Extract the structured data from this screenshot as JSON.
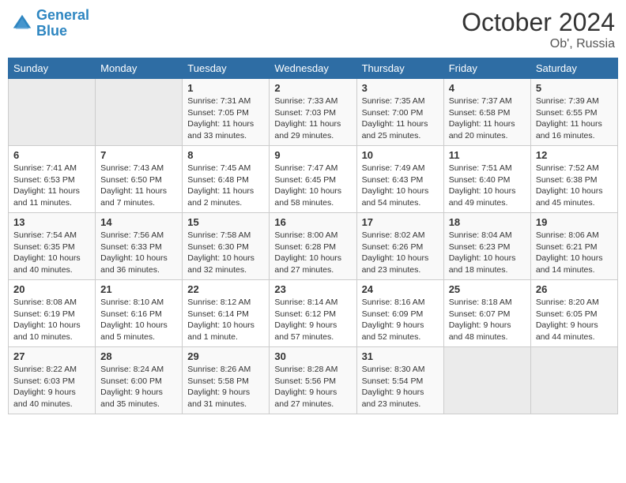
{
  "header": {
    "logo_line1": "General",
    "logo_line2": "Blue",
    "month": "October 2024",
    "location": "Ob', Russia"
  },
  "weekdays": [
    "Sunday",
    "Monday",
    "Tuesday",
    "Wednesday",
    "Thursday",
    "Friday",
    "Saturday"
  ],
  "weeks": [
    [
      null,
      null,
      {
        "day": "1",
        "sunrise": "Sunrise: 7:31 AM",
        "sunset": "Sunset: 7:05 PM",
        "daylight": "Daylight: 11 hours and 33 minutes."
      },
      {
        "day": "2",
        "sunrise": "Sunrise: 7:33 AM",
        "sunset": "Sunset: 7:03 PM",
        "daylight": "Daylight: 11 hours and 29 minutes."
      },
      {
        "day": "3",
        "sunrise": "Sunrise: 7:35 AM",
        "sunset": "Sunset: 7:00 PM",
        "daylight": "Daylight: 11 hours and 25 minutes."
      },
      {
        "day": "4",
        "sunrise": "Sunrise: 7:37 AM",
        "sunset": "Sunset: 6:58 PM",
        "daylight": "Daylight: 11 hours and 20 minutes."
      },
      {
        "day": "5",
        "sunrise": "Sunrise: 7:39 AM",
        "sunset": "Sunset: 6:55 PM",
        "daylight": "Daylight: 11 hours and 16 minutes."
      }
    ],
    [
      {
        "day": "6",
        "sunrise": "Sunrise: 7:41 AM",
        "sunset": "Sunset: 6:53 PM",
        "daylight": "Daylight: 11 hours and 11 minutes."
      },
      {
        "day": "7",
        "sunrise": "Sunrise: 7:43 AM",
        "sunset": "Sunset: 6:50 PM",
        "daylight": "Daylight: 11 hours and 7 minutes."
      },
      {
        "day": "8",
        "sunrise": "Sunrise: 7:45 AM",
        "sunset": "Sunset: 6:48 PM",
        "daylight": "Daylight: 11 hours and 2 minutes."
      },
      {
        "day": "9",
        "sunrise": "Sunrise: 7:47 AM",
        "sunset": "Sunset: 6:45 PM",
        "daylight": "Daylight: 10 hours and 58 minutes."
      },
      {
        "day": "10",
        "sunrise": "Sunrise: 7:49 AM",
        "sunset": "Sunset: 6:43 PM",
        "daylight": "Daylight: 10 hours and 54 minutes."
      },
      {
        "day": "11",
        "sunrise": "Sunrise: 7:51 AM",
        "sunset": "Sunset: 6:40 PM",
        "daylight": "Daylight: 10 hours and 49 minutes."
      },
      {
        "day": "12",
        "sunrise": "Sunrise: 7:52 AM",
        "sunset": "Sunset: 6:38 PM",
        "daylight": "Daylight: 10 hours and 45 minutes."
      }
    ],
    [
      {
        "day": "13",
        "sunrise": "Sunrise: 7:54 AM",
        "sunset": "Sunset: 6:35 PM",
        "daylight": "Daylight: 10 hours and 40 minutes."
      },
      {
        "day": "14",
        "sunrise": "Sunrise: 7:56 AM",
        "sunset": "Sunset: 6:33 PM",
        "daylight": "Daylight: 10 hours and 36 minutes."
      },
      {
        "day": "15",
        "sunrise": "Sunrise: 7:58 AM",
        "sunset": "Sunset: 6:30 PM",
        "daylight": "Daylight: 10 hours and 32 minutes."
      },
      {
        "day": "16",
        "sunrise": "Sunrise: 8:00 AM",
        "sunset": "Sunset: 6:28 PM",
        "daylight": "Daylight: 10 hours and 27 minutes."
      },
      {
        "day": "17",
        "sunrise": "Sunrise: 8:02 AM",
        "sunset": "Sunset: 6:26 PM",
        "daylight": "Daylight: 10 hours and 23 minutes."
      },
      {
        "day": "18",
        "sunrise": "Sunrise: 8:04 AM",
        "sunset": "Sunset: 6:23 PM",
        "daylight": "Daylight: 10 hours and 18 minutes."
      },
      {
        "day": "19",
        "sunrise": "Sunrise: 8:06 AM",
        "sunset": "Sunset: 6:21 PM",
        "daylight": "Daylight: 10 hours and 14 minutes."
      }
    ],
    [
      {
        "day": "20",
        "sunrise": "Sunrise: 8:08 AM",
        "sunset": "Sunset: 6:19 PM",
        "daylight": "Daylight: 10 hours and 10 minutes."
      },
      {
        "day": "21",
        "sunrise": "Sunrise: 8:10 AM",
        "sunset": "Sunset: 6:16 PM",
        "daylight": "Daylight: 10 hours and 5 minutes."
      },
      {
        "day": "22",
        "sunrise": "Sunrise: 8:12 AM",
        "sunset": "Sunset: 6:14 PM",
        "daylight": "Daylight: 10 hours and 1 minute."
      },
      {
        "day": "23",
        "sunrise": "Sunrise: 8:14 AM",
        "sunset": "Sunset: 6:12 PM",
        "daylight": "Daylight: 9 hours and 57 minutes."
      },
      {
        "day": "24",
        "sunrise": "Sunrise: 8:16 AM",
        "sunset": "Sunset: 6:09 PM",
        "daylight": "Daylight: 9 hours and 52 minutes."
      },
      {
        "day": "25",
        "sunrise": "Sunrise: 8:18 AM",
        "sunset": "Sunset: 6:07 PM",
        "daylight": "Daylight: 9 hours and 48 minutes."
      },
      {
        "day": "26",
        "sunrise": "Sunrise: 8:20 AM",
        "sunset": "Sunset: 6:05 PM",
        "daylight": "Daylight: 9 hours and 44 minutes."
      }
    ],
    [
      {
        "day": "27",
        "sunrise": "Sunrise: 8:22 AM",
        "sunset": "Sunset: 6:03 PM",
        "daylight": "Daylight: 9 hours and 40 minutes."
      },
      {
        "day": "28",
        "sunrise": "Sunrise: 8:24 AM",
        "sunset": "Sunset: 6:00 PM",
        "daylight": "Daylight: 9 hours and 35 minutes."
      },
      {
        "day": "29",
        "sunrise": "Sunrise: 8:26 AM",
        "sunset": "Sunset: 5:58 PM",
        "daylight": "Daylight: 9 hours and 31 minutes."
      },
      {
        "day": "30",
        "sunrise": "Sunrise: 8:28 AM",
        "sunset": "Sunset: 5:56 PM",
        "daylight": "Daylight: 9 hours and 27 minutes."
      },
      {
        "day": "31",
        "sunrise": "Sunrise: 8:30 AM",
        "sunset": "Sunset: 5:54 PM",
        "daylight": "Daylight: 9 hours and 23 minutes."
      },
      null,
      null
    ]
  ]
}
